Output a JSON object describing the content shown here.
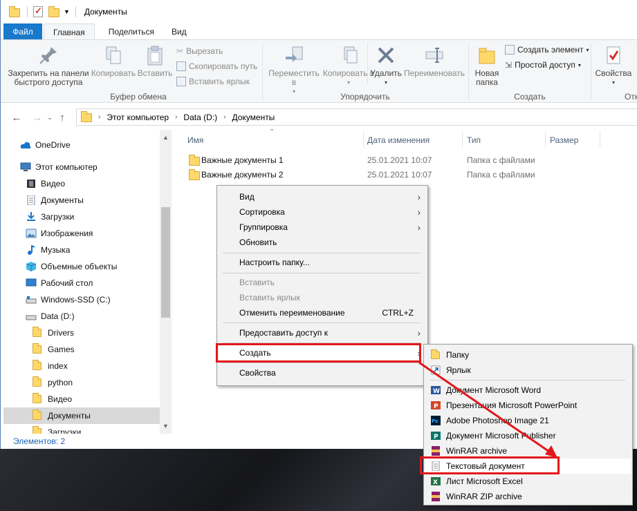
{
  "window": {
    "title": "Документы"
  },
  "ribbon_tabs": [
    "Файл",
    "Главная",
    "Поделиться",
    "Вид"
  ],
  "ribbon": {
    "clipboard": {
      "label": "Буфер обмена",
      "pin": "Закрепить на панели быстрого доступа",
      "copy": "Копировать",
      "paste": "Вставить",
      "cut": "Вырезать",
      "copy_path": "Скопировать путь",
      "paste_shortcut": "Вставить ярлык"
    },
    "organize": {
      "label": "Упорядочить",
      "move": "Переместить в",
      "copy_to": "Копировать в",
      "delete": "Удалить",
      "rename": "Переименовать"
    },
    "create": {
      "label": "Создать",
      "new_folder": "Новая папка",
      "new_item": "Создать элемент",
      "easy_access": "Простой доступ"
    },
    "open": {
      "label": "Отк",
      "properties": "Свойства"
    }
  },
  "address": {
    "crumbs": [
      "Этот компьютер",
      "Data (D:)",
      "Документы"
    ]
  },
  "nav_pane": [
    {
      "label": "OneDrive"
    },
    {
      "label": "Этот компьютер"
    },
    {
      "label": "Видео"
    },
    {
      "label": "Документы"
    },
    {
      "label": "Загрузки"
    },
    {
      "label": "Изображения"
    },
    {
      "label": "Музыка"
    },
    {
      "label": "Объемные объекты"
    },
    {
      "label": "Рабочий стол"
    },
    {
      "label": "Windows-SSD (C:)"
    },
    {
      "label": "Data (D:)"
    },
    {
      "label": "Drivers"
    },
    {
      "label": "Games"
    },
    {
      "label": "index"
    },
    {
      "label": "python"
    },
    {
      "label": "Видео"
    },
    {
      "label": "Документы"
    },
    {
      "label": "Загрузки"
    }
  ],
  "columns": [
    "Имя",
    "Дата изменения",
    "Тип",
    "Размер"
  ],
  "files": [
    {
      "name": "Важные документы 1",
      "date": "25.01.2021 10:07",
      "type": "Папка с файлами"
    },
    {
      "name": "Важные документы 2",
      "date": "25.01.2021 10:07",
      "type": "Папка с файлами"
    }
  ],
  "status": "Элементов: 2",
  "context_menu": {
    "view": "Вид",
    "sort": "Сортировка",
    "group": "Группировка",
    "refresh": "Обновить",
    "customize": "Настроить папку...",
    "paste": "Вставить",
    "paste_shortcut": "Вставить ярлык",
    "undo_rename": "Отменить переименование",
    "undo_shortcut": "CTRL+Z",
    "share": "Предоставить доступ к",
    "create": "Создать",
    "properties": "Свойства"
  },
  "submenu": {
    "folder": "Папку",
    "shortcut": "Ярлык",
    "word": "Документ Microsoft Word",
    "powerpoint": "Презентация Microsoft PowerPoint",
    "photoshop": "Adobe Photoshop Image 21",
    "publisher": "Документ Microsoft Publisher",
    "winrar": "WinRAR archive",
    "text": "Текстовый документ",
    "excel": "Лист Microsoft Excel",
    "winrar_zip": "WinRAR ZIP archive"
  },
  "colors": {
    "accent": "#1979ca",
    "highlight": "#e3161b",
    "folder": "#ffd86b"
  }
}
